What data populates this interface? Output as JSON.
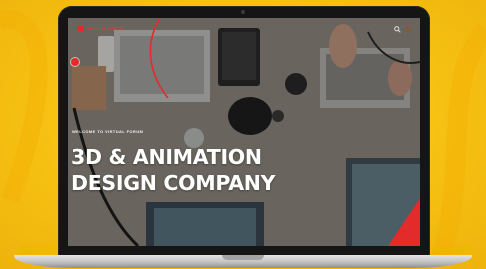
{
  "website": {
    "logo_text": "VIRTUAL FORUM",
    "hero_kicker": "WELCOME TO VIRTUAL FORUM",
    "hero_title_line1": "3D & ANIMATION",
    "hero_title_line2": "DESIGN COMPANY"
  },
  "nav_icons": [
    "search-icon",
    "menu-icon"
  ],
  "colors": {
    "background": "#f7c212",
    "accent": "#e32b2b",
    "laptop_bezel": "#151515",
    "laptop_base": "#c9c9c9",
    "hero_text": "#ffffff"
  }
}
